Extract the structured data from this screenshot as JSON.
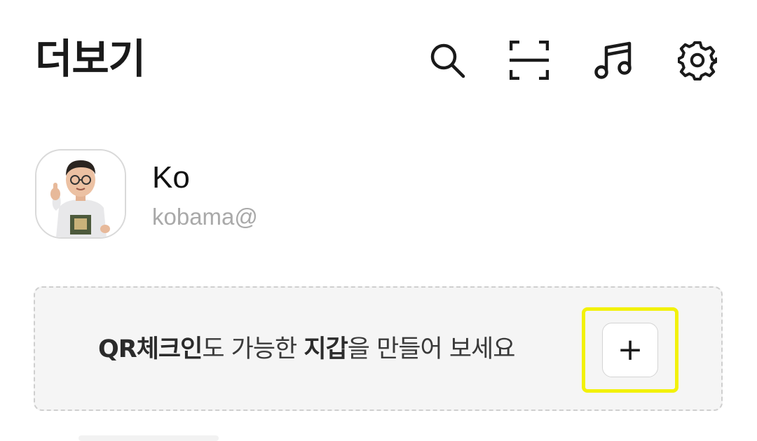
{
  "header": {
    "title": "더보기",
    "icons": [
      "search-icon",
      "scan-icon",
      "music-icon",
      "settings-icon"
    ]
  },
  "profile": {
    "name": "Ko",
    "email": "kobama@"
  },
  "wallet_banner": {
    "text_bold_1": "QR체크인",
    "text_1": "도 가능한 ",
    "text_bold_2": "지갑",
    "text_2": "을 만들어 보세요",
    "add_label": "+"
  },
  "colors": {
    "highlight": "#f2f10a",
    "banner_bg": "#f5f5f5",
    "email": "#a9a9a9"
  }
}
